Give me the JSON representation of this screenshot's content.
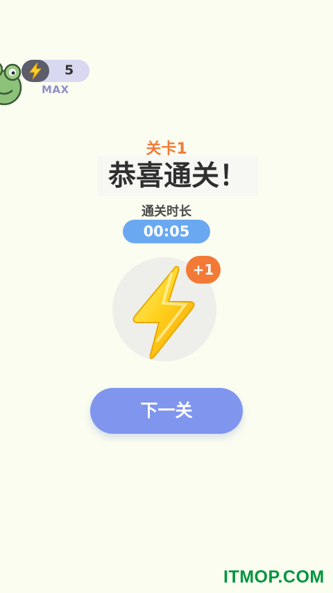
{
  "energy": {
    "count": "5",
    "max_label": "MAX",
    "icon": "lightning-bolt-icon",
    "avatar_icon": "frog-avatar-icon"
  },
  "level": {
    "label": "关卡1",
    "title": "恭喜通关！"
  },
  "timer": {
    "label": "通关时长",
    "value": "00:05"
  },
  "reward": {
    "icon": "lightning-bolt-icon",
    "badge": "+1"
  },
  "actions": {
    "next_label": "下一关"
  },
  "watermark": "ITMOP.COM",
  "colors": {
    "background": "#fbfdf0",
    "accent_orange": "#f37a36",
    "timer_blue": "#6aa8f2",
    "button_purple": "#7f95ee",
    "watermark_green": "#00953f"
  }
}
